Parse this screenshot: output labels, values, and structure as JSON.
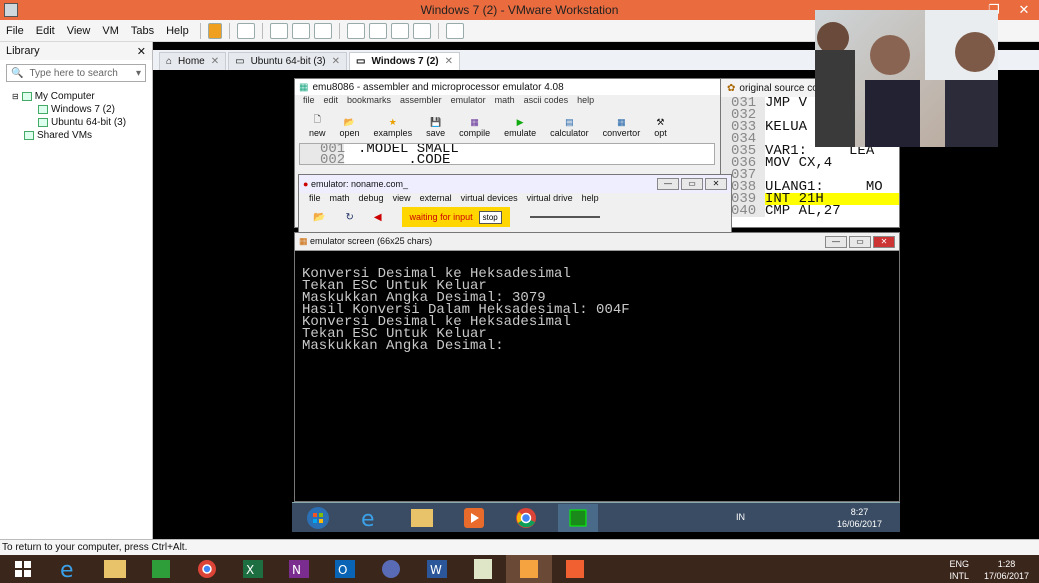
{
  "window": {
    "title": "Windows 7 (2) - VMware Workstation"
  },
  "menubar": {
    "items": [
      "File",
      "Edit",
      "View",
      "VM",
      "Tabs",
      "Help"
    ]
  },
  "library": {
    "title": "Library",
    "search_placeholder": "Type here to search",
    "tree": [
      "My Computer",
      "Windows 7 (2)",
      "Ubuntu 64-bit (3)",
      "Shared VMs"
    ]
  },
  "tabs": [
    {
      "label": "Home"
    },
    {
      "label": "Ubuntu 64-bit (3)"
    },
    {
      "label": "Windows 7 (2)"
    }
  ],
  "emu": {
    "title": "emu8086 - assembler and microprocessor emulator 4.08",
    "menus": [
      "file",
      "edit",
      "bookmarks",
      "assembler",
      "emulator",
      "math",
      "ascii codes",
      "help"
    ],
    "tools": [
      "new",
      "open",
      "examples",
      "save",
      "compile",
      "emulate",
      "calculator",
      "convertor",
      "opt"
    ],
    "code_lines": [
      {
        "num": "001",
        "text": ".MODEL SMALL"
      },
      {
        "num": "002",
        "text": "      .CODE"
      }
    ]
  },
  "source": {
    "title": "original source code",
    "lines": [
      {
        "num": "031",
        "text": "JMP V"
      },
      {
        "num": "032",
        "text": ""
      },
      {
        "num": "033",
        "text": "KELUA"
      },
      {
        "num": "034",
        "text": ""
      },
      {
        "num": "035",
        "text": "VAR1:     LEA"
      },
      {
        "num": "036",
        "text": "MOV CX,4"
      },
      {
        "num": "037",
        "text": ""
      },
      {
        "num": "038",
        "text": "ULANG1:     MO"
      },
      {
        "num": "039",
        "text": "INT 21H"
      },
      {
        "num": "040",
        "text": "CMP AL,27"
      }
    ]
  },
  "emulator": {
    "title": "emulator: noname.com_",
    "menus": [
      "file",
      "math",
      "debug",
      "view",
      "external",
      "virtual devices",
      "virtual drive",
      "help"
    ],
    "status": "waiting for input",
    "stop": "stop"
  },
  "screen": {
    "title": "emulator screen (66x25 chars)",
    "lines": [
      "Konversi Desimal ke Heksadesimal",
      "Tekan ESC Untuk Keluar",
      "Maskukkan Angka Desimal: 3079",
      "Hasil Konversi Dalam Heksadesimal: 004F",
      "Konversi Desimal ke Heksadesimal",
      "Tekan ESC Untuk Keluar",
      "Maskukkan Angka Desimal:"
    ]
  },
  "guest_taskbar": {
    "lang": "IN",
    "time": "8:27",
    "date": "16/06/2017"
  },
  "status": {
    "text": "To return to your computer, press Ctrl+Alt."
  },
  "host_taskbar": {
    "lang": "ENG",
    "lang2": "INTL",
    "time": "1:28",
    "date": "17/06/2017"
  }
}
